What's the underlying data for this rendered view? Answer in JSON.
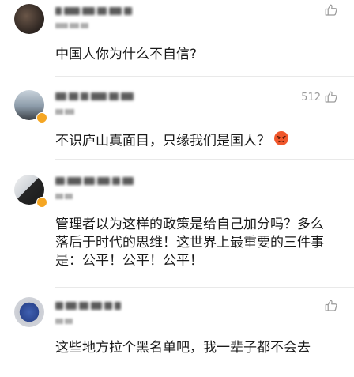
{
  "comments": [
    {
      "text": "中国人你为什么不自信?",
      "likes": ""
    },
    {
      "text": "不识庐山真面目，只缘我们是国人？",
      "likes": "512",
      "emoji": "angry-face"
    },
    {
      "text": "管理者以为这样的政策是给自己加分吗？多么落后于时代的思维！这世界上最重要的三件事是：公平！公平！公平！",
      "likes": ""
    },
    {
      "text": "这些地方拉个黑名单吧，我一辈子都不会去",
      "likes": ""
    }
  ],
  "icons": {
    "like": "thumbs-up-icon",
    "verified": "verified-badge-icon",
    "emoji": "angry-face-emoji"
  },
  "colors": {
    "text": "#1a1a1a",
    "muted": "#9a9a9a",
    "badge": "#f5a623",
    "divider": "#e9e9e9"
  }
}
